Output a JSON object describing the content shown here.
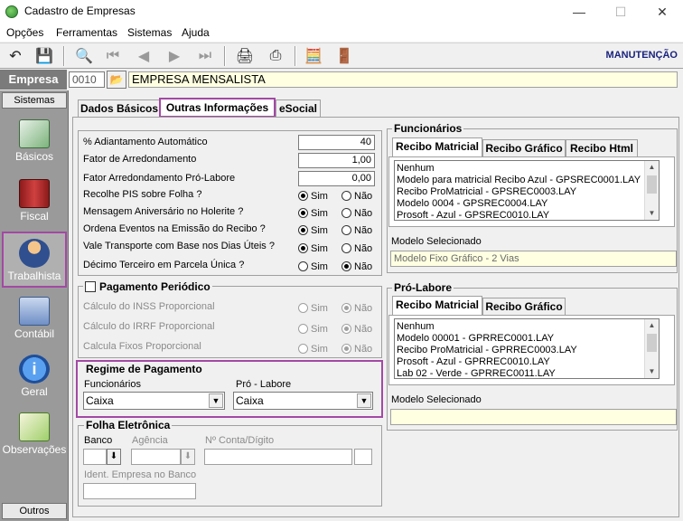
{
  "window": {
    "title": "Cadastro de Empresas",
    "minimize": "—",
    "maximize": "☐",
    "close": "✕"
  },
  "menu": {
    "items": [
      "Opções",
      "Ferramentas",
      "Sistemas",
      "Ajuda"
    ]
  },
  "toolbar": {
    "mode_label": "MANUTENÇÃO"
  },
  "empresa": {
    "label": "Empresa",
    "code": "0010",
    "name": "EMPRESA MENSALISTA"
  },
  "sidebar": {
    "header": "Sistemas",
    "footer": "Outros",
    "items": [
      {
        "label": "Básicos",
        "icon": "document-icon"
      },
      {
        "label": "Fiscal",
        "icon": "ledger-icon"
      },
      {
        "label": "Trabalhista",
        "icon": "worker-icon"
      },
      {
        "label": "Contábil",
        "icon": "calculator-icon"
      },
      {
        "label": "Geral",
        "icon": "info-icon"
      },
      {
        "label": "Observações",
        "icon": "notepad-icon"
      }
    ]
  },
  "tabs": [
    "Dados Básicos",
    "Outras Informações",
    "eSocial"
  ],
  "general": {
    "adiantamento_label": "% Adiantamento Automático",
    "adiantamento_value": "40",
    "fator_label": "Fator de Arredondamento",
    "fator_value": "1,00",
    "fator_pro_label": "Fator Arredondamento Pró-Labore",
    "fator_pro_value": "0,00",
    "sim": "Sim",
    "nao": "Não",
    "questions": [
      {
        "label": "Recolhe PIS sobre Folha ?",
        "value": "sim"
      },
      {
        "label": "Mensagem Aniversário no Holerite ?",
        "value": "sim"
      },
      {
        "label": "Ordena Eventos na Emissão do Recibo ?",
        "value": "sim"
      },
      {
        "label": "Vale Transporte com Base nos Dias Úteis ?",
        "value": "sim"
      },
      {
        "label": "Décimo Terceiro em Parcela Única ?",
        "value": "nao"
      }
    ]
  },
  "pagamento_periodico": {
    "label": "Pagamento Periódico",
    "rows": [
      "Cálculo do INSS Proporcional",
      "Cálculo do IRRF Proporcional",
      "Calcula Fixos Proporcional"
    ]
  },
  "regime": {
    "title": "Regime de Pagamento",
    "funcionarios_label": "Funcionários",
    "funcionarios_value": "Caixa",
    "prolabore_label": "Pró - Labore",
    "prolabore_value": "Caixa"
  },
  "folha": {
    "title": "Folha Eletrônica",
    "banco_label": "Banco",
    "agencia_label": "Agência",
    "conta_label": "Nº Conta/Dígito",
    "ident_label": "Ident. Empresa no Banco"
  },
  "funcionarios": {
    "title": "Funcionários",
    "tabs": [
      "Recibo Matricial",
      "Recibo Gráfico",
      "Recibo Html"
    ],
    "list": [
      "Nenhum",
      "Modelo para matricial Recibo Azul - GPSREC0001.LAY",
      "Recibo ProMatricial - GPSREC0003.LAY",
      "Modelo 0004 - GPSREC0004.LAY",
      "Prosoft - Azul - GPSREC0010.LAY"
    ],
    "selected_label": "Modelo Selecionado",
    "selected_value": "Modelo Fixo Gráfico - 2 Vias"
  },
  "prolabore": {
    "title": "Pró-Labore",
    "tabs": [
      "Recibo Matricial",
      "Recibo Gráfico"
    ],
    "list": [
      "Nenhum",
      "Modelo 00001 - GPRREC0001.LAY",
      "Recibo ProMatricial - GPRREC0003.LAY",
      "Prosoft - Azul - GPRREC0010.LAY",
      "Lab 02 - Verde - GPRREC0011.LAY"
    ],
    "selected_label": "Modelo Selecionado",
    "selected_value": ""
  }
}
